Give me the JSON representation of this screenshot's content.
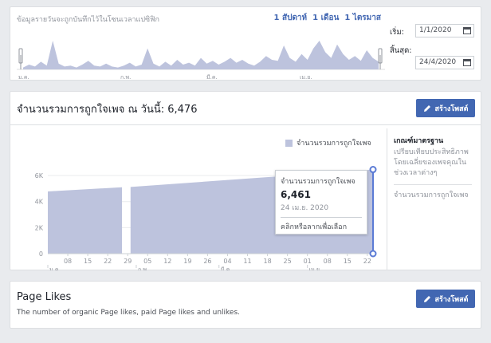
{
  "range": {
    "description": "ข้อมูลรายวันจะถูกบันทึกไว้ในโซนเวลาแปซิฟิก",
    "links": [
      "1 สัปดาห์",
      "1 เดือน",
      "1 ไตรมาส"
    ],
    "start_label": "เริ่ม:",
    "start_value": "1/1/2020",
    "end_label": "สิ้นสุด:",
    "end_value": "24/4/2020",
    "mini_months": [
      "ม.ค.",
      "ก.พ.",
      "มี.ค.",
      "เม.ย."
    ]
  },
  "main": {
    "header": "จำนวนรวมการถูกใจเพจ ณ วันนี้: 6,476",
    "create_post": "สร้างโพสต์",
    "legend": "จำนวนรวมการถูกใจเพจ"
  },
  "chart_data": {
    "type": "area",
    "y_ticks": [
      "6K",
      "4K",
      "2K",
      "0"
    ],
    "ylim": [
      0,
      6800
    ],
    "x_day_ticks": [
      "08",
      "15",
      "22",
      "29",
      "05",
      "12",
      "19",
      "26",
      "04",
      "11",
      "18",
      "25",
      "01",
      "08",
      "15",
      "22"
    ],
    "x_month_ticks": [
      "ม.ค.",
      "ก.พ.",
      "มี.ค.",
      "เม.ย."
    ],
    "series": [
      {
        "name": "จำนวนรวมการถูกใจเพจ",
        "color": "#bdc3dd",
        "segments": [
          {
            "start": "2020-01-01",
            "end": "2020-01-27",
            "values": [
              4780,
              5100
            ]
          },
          {
            "start": "2020-01-30",
            "end": "2020-04-24",
            "values": [
              5120,
              6461
            ]
          }
        ]
      }
    ],
    "tooltip": {
      "title": "จำนวนรวมการถูกใจเพจ",
      "value": "6,461",
      "date": "24 เม.ย. 2020",
      "hint": "คลิกหรือลากเพื่อเลือก"
    }
  },
  "side": {
    "title": "เกณฑ์มาตรฐาน",
    "text": "เปรียบเทียบประสิทธิภาพโดยเฉลี่ยของเพจคุณในช่วงเวลาต่างๆ",
    "item": "จำนวนรวมการถูกใจเพจ"
  },
  "page_likes": {
    "title": "Page Likes",
    "subtitle": "The number of organic Page likes, paid Page likes and unlikes.",
    "create_post": "สร้างโพสต์"
  },
  "colors": {
    "accent": "#4267b2",
    "area": "#bdc3dd",
    "marker": "#5b7bd5"
  }
}
